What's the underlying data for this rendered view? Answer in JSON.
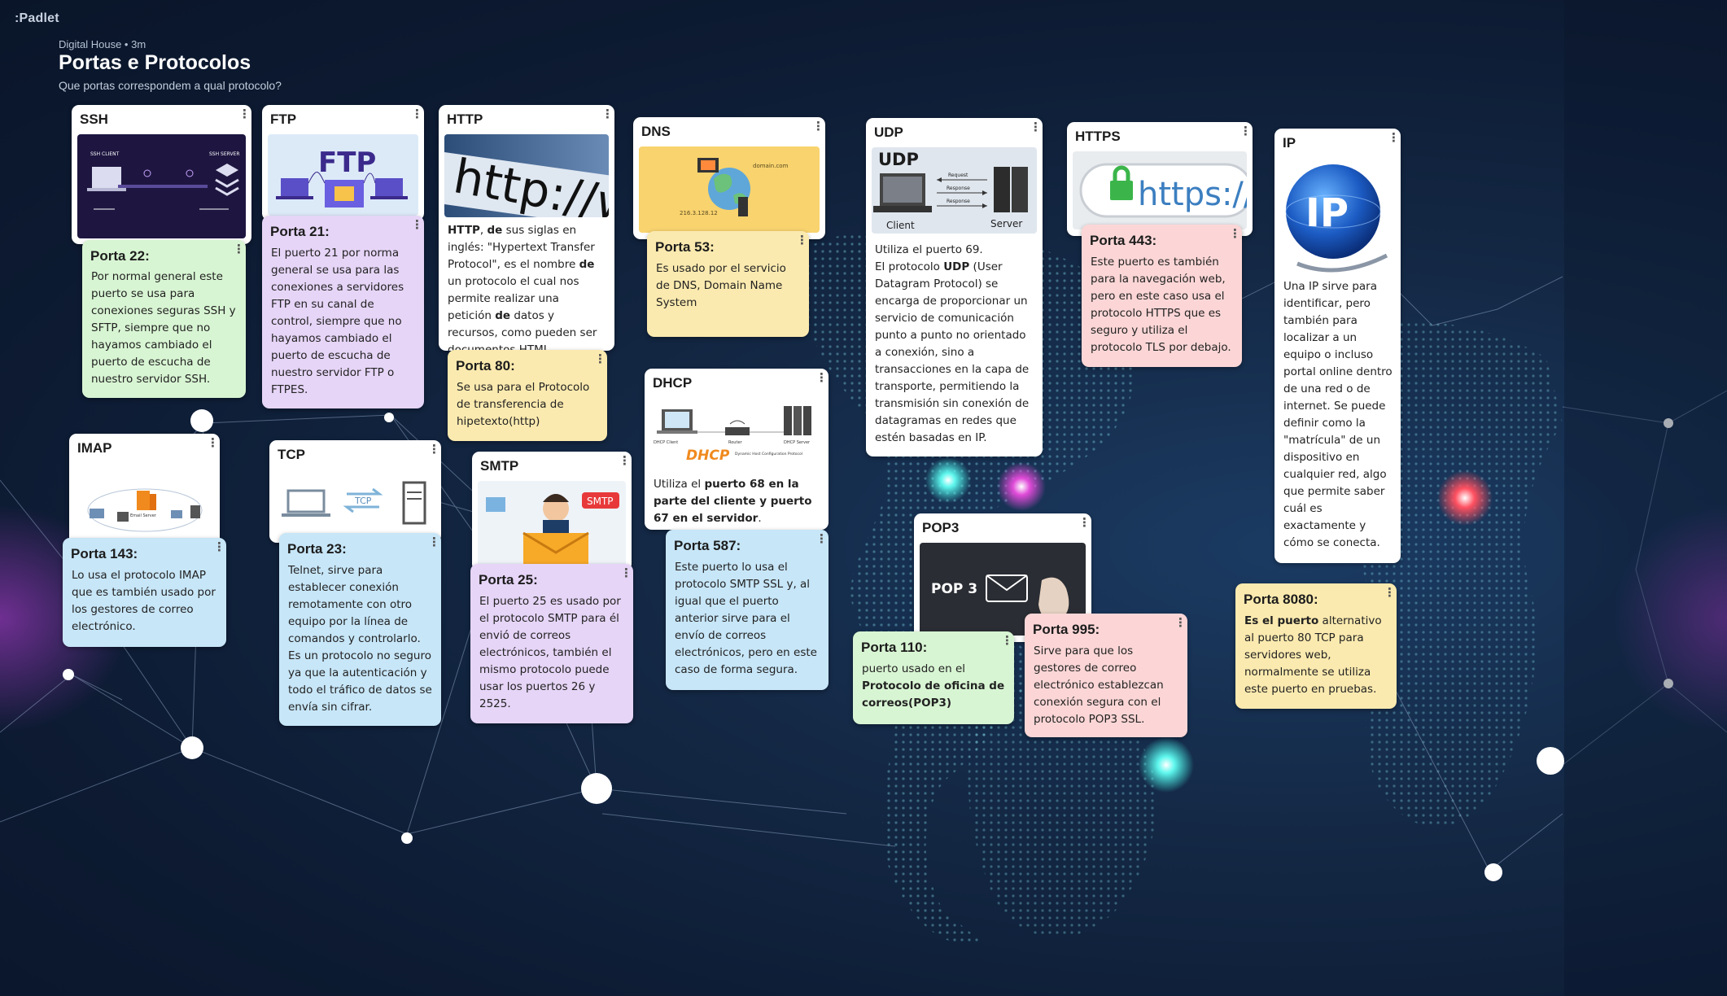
{
  "app": {
    "logo": ":Padlet"
  },
  "board": {
    "meta": "Digital House • 3m",
    "title": "Portas e Protocolos",
    "subtitle": "Que portas correspondem a qual protocolo?"
  },
  "colors": {
    "background": "#0f1f3b",
    "white_card": "#ffffff",
    "green_card": "#d8f5d3",
    "purple_card": "#e6d5f7",
    "yellow_card": "#fbeaaf",
    "blue_card": "#c7e6f8",
    "pink_card": "#fcd6d6",
    "node_glow": "#3ff2e6",
    "node_magenta": "#e04ad8",
    "node_red": "#ff5060"
  },
  "menu_icon": "more-vertical-icon",
  "cards": {
    "ssh": {
      "title": "SSH",
      "image": {
        "left": "SSH CLIENT",
        "right": "SSH SERVER"
      }
    },
    "porta22": {
      "title": "Porta 22:",
      "body": "Por normal general este puerto se usa para conexiones seguras SSH y SFTP, siempre que no hayamos cambiado el puerto de escucha de nuestro servidor SSH."
    },
    "ftp": {
      "title": "FTP",
      "image": {
        "label": "FTP"
      }
    },
    "porta21": {
      "title": "Porta 21:",
      "body": " El puerto 21 por norma general se usa para las conexiones a servidores FTP en su canal de control, siempre que no hayamos cambiado el puerto de escucha de nuestro servidor FTP o FTPES."
    },
    "http": {
      "title": "HTTP",
      "image": {
        "label": "http://ww"
      },
      "body_strong1": "HTTP",
      "body_t1": ", ",
      "body_strong2": "de",
      "body_t2": " sus siglas en inglés: \"Hypertext Transfer Protocol\", es el nombre ",
      "body_strong3": "de",
      "body_t3": " un protocolo el cual nos permite realizar una petición ",
      "body_strong4": "de",
      "body_t4": " datos y recursos, como pueden ser documentos HTML."
    },
    "porta80": {
      "title": "Porta 80:",
      "body": "Se usa para el Protocolo de transferencia de hipetexto(http)"
    },
    "dns": {
      "title": "DNS",
      "image": {
        "domain": "domain.com",
        "ip": "216.3.128.12"
      }
    },
    "porta53": {
      "title": "Porta 53:",
      "body": "Es usado por el servicio de DNS, Domain Name System"
    },
    "dhcp": {
      "title": "DHCP",
      "image": {
        "client": "DHCP Client",
        "router": "Router",
        "server": "DHCP Server",
        "label": "DHCP",
        "caption": "Dynamic Host Configuration Protocol"
      },
      "body_t1": "Utiliza el ",
      "body_strong1": "puerto 68 en la parte del cliente y puerto 67 en el servidor",
      "body_t2": "."
    },
    "porta587": {
      "title": "Porta 587:",
      "body": "Este puerto lo usa el protocolo SMTP SSL y, al igual que el puerto anterior sirve para el envío de correos electrónicos, pero en este caso de forma segura."
    },
    "udp": {
      "title": "UDP",
      "image": {
        "label": "UDP",
        "request": "Request",
        "response": "Response",
        "client": "Client",
        "server": "Server"
      },
      "body_line1": "Utiliza el puerto 69.",
      "body_t1": "El protocolo ",
      "body_strong1": "UDP",
      "body_t2": " (User Datagram Protocol) se encarga de proporcionar un servicio de comunicación punto a punto no orientado a conexión, sino a transacciones en la capa de transporte, permitiendo la transmisión sin conexión de datagramas en redes que estén basadas en IP."
    },
    "https": {
      "title": "HTTPS",
      "image": {
        "label": "https://"
      }
    },
    "porta443": {
      "title": "Porta 443:",
      "body": "Este puerto es también para la navegación web, pero en este caso usa el protocolo HTTPS que es seguro y utiliza el protocolo TLS por debajo."
    },
    "ip": {
      "title": "IP",
      "image": {
        "label": "IP"
      },
      "body": "Una IP sirve para identificar, pero también para localizar a un equipo o incluso portal online dentro de una red o de internet. Se puede definir como la \"matrícula\" de un dispositivo en cualquier red, algo que permite saber cuál es exactamente y cómo se conecta."
    },
    "porta8080": {
      "title": "Porta 8080:",
      "body_strong1": " Es el puerto",
      "body_t1": " alternativo al puerto 80 TCP para servidores web, normalmente se utiliza este puerto en pruebas."
    },
    "imap": {
      "title": "IMAP",
      "image": {
        "label": "Email Server"
      }
    },
    "porta143": {
      "title": "Porta 143:",
      "body": "Lo usa el protocolo IMAP que es también usado por los gestores de correo electrónico."
    },
    "tcp": {
      "title": "TCP",
      "image": {
        "label": "TCP"
      }
    },
    "porta23": {
      "title": "Porta 23:",
      "body": "Telnet, sirve para establecer conexión remotamente con otro equipo por la línea de comandos y controlarlo. Es un protocolo no seguro ya que la autenticación y todo el tráfico de datos se envía sin cifrar."
    },
    "smtp": {
      "title": "SMTP",
      "image": {
        "label": "SMTP"
      }
    },
    "porta25": {
      "title": "Porta 25:",
      "body": "El puerto 25 es usado por el protocolo SMTP para él envió de correos electrónicos, también el mismo protocolo puede usar los puertos 26 y 2525."
    },
    "pop3": {
      "title": "POP3",
      "image": {
        "label": "POP 3"
      }
    },
    "porta110": {
      "title": "Porta 110:",
      "body_t1": "puerto usado en el ",
      "body_strong1": "Protocolo de oficina de correos(POP3)"
    },
    "porta995": {
      "title": "Porta 995:",
      "body": " Sirve para que los gestores de correo electrónico establezcan conexión segura con el protocolo POP3 SSL."
    }
  }
}
